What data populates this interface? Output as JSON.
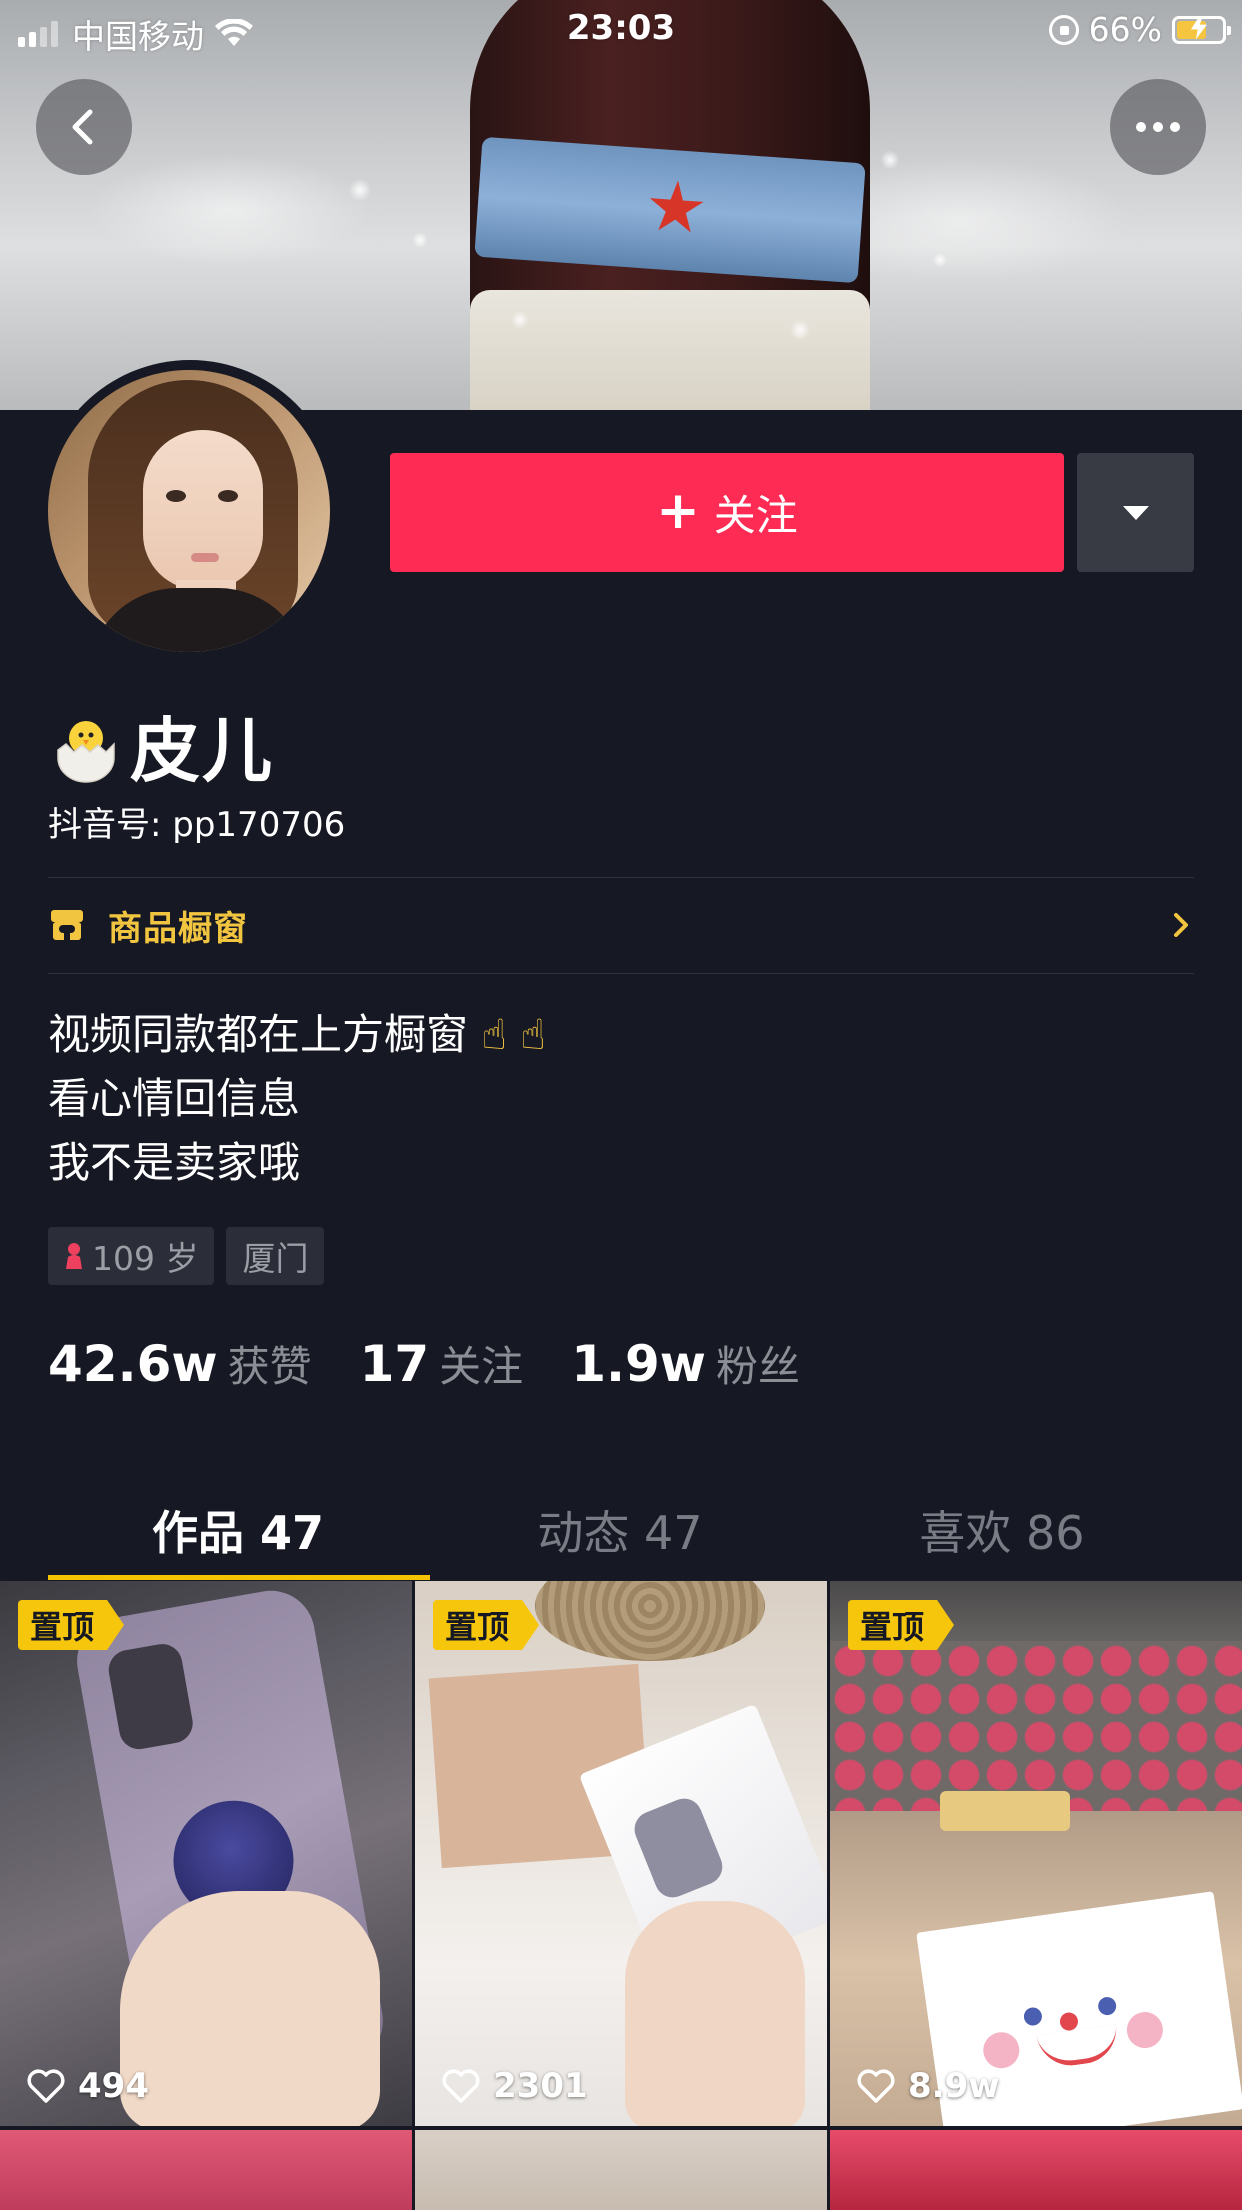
{
  "status_bar": {
    "carrier": "中国移动",
    "time": "23:03",
    "battery": "66%",
    "battery_level": 0.66
  },
  "header": {
    "back_icon": "chevron-left-icon",
    "more_icon": "more-dots-icon"
  },
  "profile": {
    "follow_label": "关注",
    "nickname_emoji": "hatching-chick-icon",
    "nickname": "皮儿",
    "douyin_id": "抖音号: pp170706",
    "shop_label": "商品橱窗",
    "bio_line1": "视频同款都在上方橱窗",
    "bio_hand": "☝ ☝",
    "bio_line2": "看心情回信息",
    "bio_line3": "我不是卖家哦",
    "age_tag": "109 岁",
    "location_tag": "厦门"
  },
  "stats": {
    "likes_num": "42.6w",
    "likes_label": "获赞",
    "following_num": "17",
    "following_label": "关注",
    "fans_num": "1.9w",
    "fans_label": "粉丝"
  },
  "tabs": [
    {
      "label": "作品 47",
      "active": true
    },
    {
      "label": "动态 47",
      "active": false
    },
    {
      "label": "喜欢 86",
      "active": false
    }
  ],
  "videos": [
    {
      "pinned": "置顶",
      "likes": "494"
    },
    {
      "pinned": "置顶",
      "likes": "2301"
    },
    {
      "pinned": "置顶",
      "likes": "8.9w"
    }
  ],
  "colors": {
    "background": "#161823",
    "follow_button": "#fe2c55",
    "accent_yellow": "#f4c400",
    "shop_text": "#f2c540"
  }
}
